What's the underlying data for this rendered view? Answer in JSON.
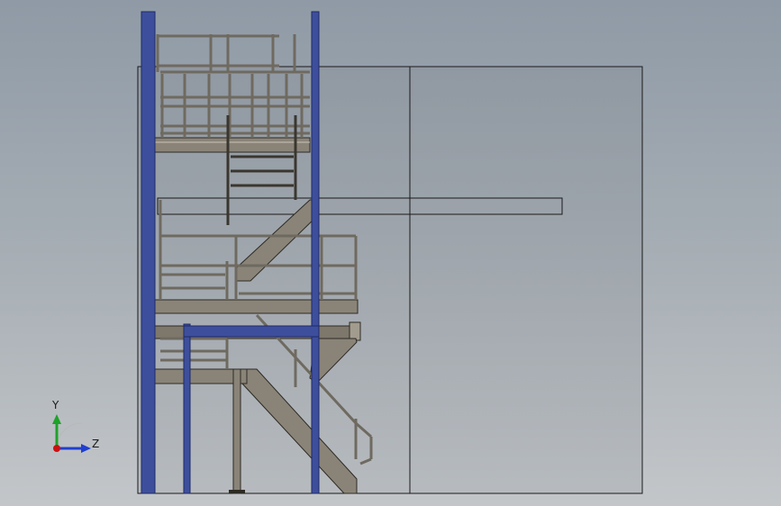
{
  "viewport": {
    "triad": {
      "y_label": "Y",
      "z_label": "Z"
    }
  },
  "colors": {
    "column_blue": "#3d4f9c",
    "column_edge": "#1e2a66",
    "steel": "#8a8478",
    "steel_edge": "#2d2a24",
    "outline": "#1a1a1a",
    "axis_y": "#1fa22a",
    "axis_z": "#1f3fd0",
    "origin": "#cc1111"
  }
}
